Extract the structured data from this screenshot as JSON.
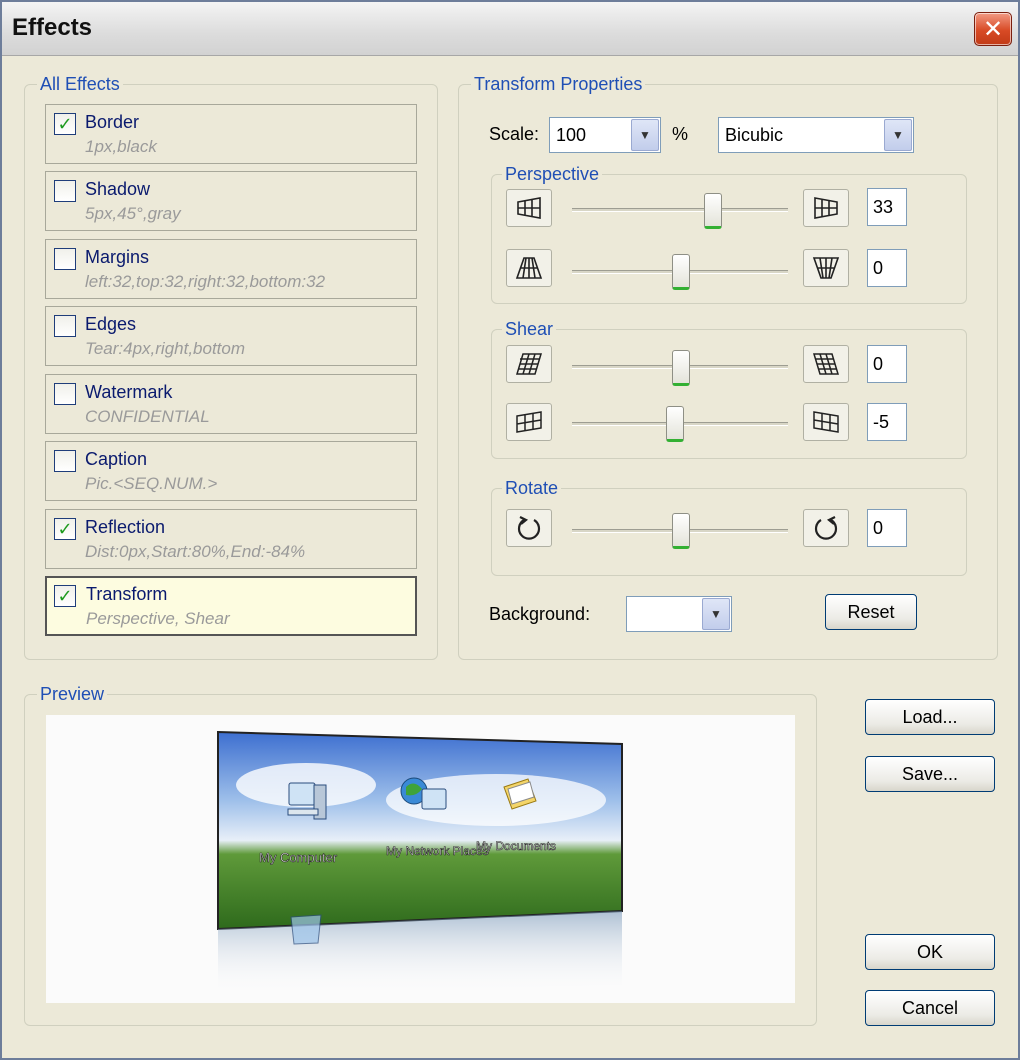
{
  "window": {
    "title": "Effects",
    "close_glyph": "✕"
  },
  "all_effects": {
    "legend": "All Effects",
    "items": [
      {
        "name": "Border",
        "desc": "1px,black",
        "checked": true
      },
      {
        "name": "Shadow",
        "desc": "5px,45°,gray",
        "checked": false
      },
      {
        "name": "Margins",
        "desc": "left:32,top:32,right:32,bottom:32",
        "checked": false
      },
      {
        "name": "Edges",
        "desc": "Tear:4px,right,bottom",
        "checked": false
      },
      {
        "name": "Watermark",
        "desc": "CONFIDENTIAL",
        "checked": false
      },
      {
        "name": "Caption",
        "desc": "Pic.<SEQ.NUM.>",
        "checked": false
      },
      {
        "name": "Reflection",
        "desc": "Dist:0px,Start:80%,End:-84%",
        "checked": true
      },
      {
        "name": "Transform",
        "desc": "Perspective, Shear",
        "checked": true
      }
    ],
    "check_glyph": "✓"
  },
  "transform": {
    "legend": "Transform Properties",
    "scale_label": "Scale:",
    "scale_value": "100",
    "percent": "%",
    "interpolation": "Bicubic",
    "perspective": {
      "legend": "Perspective",
      "horizontal": "33",
      "vertical": "0"
    },
    "shear": {
      "legend": "Shear",
      "horizontal": "0",
      "vertical": "-5"
    },
    "rotate": {
      "legend": "Rotate",
      "value": "0"
    },
    "background_label": "Background:",
    "background_value": "",
    "reset": "Reset",
    "dropdown_glyph": "▼"
  },
  "preview": {
    "legend": "Preview",
    "desktop_icons": [
      "My Computer",
      "My Network Places",
      "My Documents"
    ]
  },
  "buttons": {
    "load": "Load...",
    "save": "Save...",
    "ok": "OK",
    "cancel": "Cancel"
  },
  "colors": {
    "legend_blue": "#1f4fb5",
    "item_name": "#0a1a6e",
    "check_green": "#1e9a1e",
    "selected_item_bg": "#fdfce0"
  }
}
